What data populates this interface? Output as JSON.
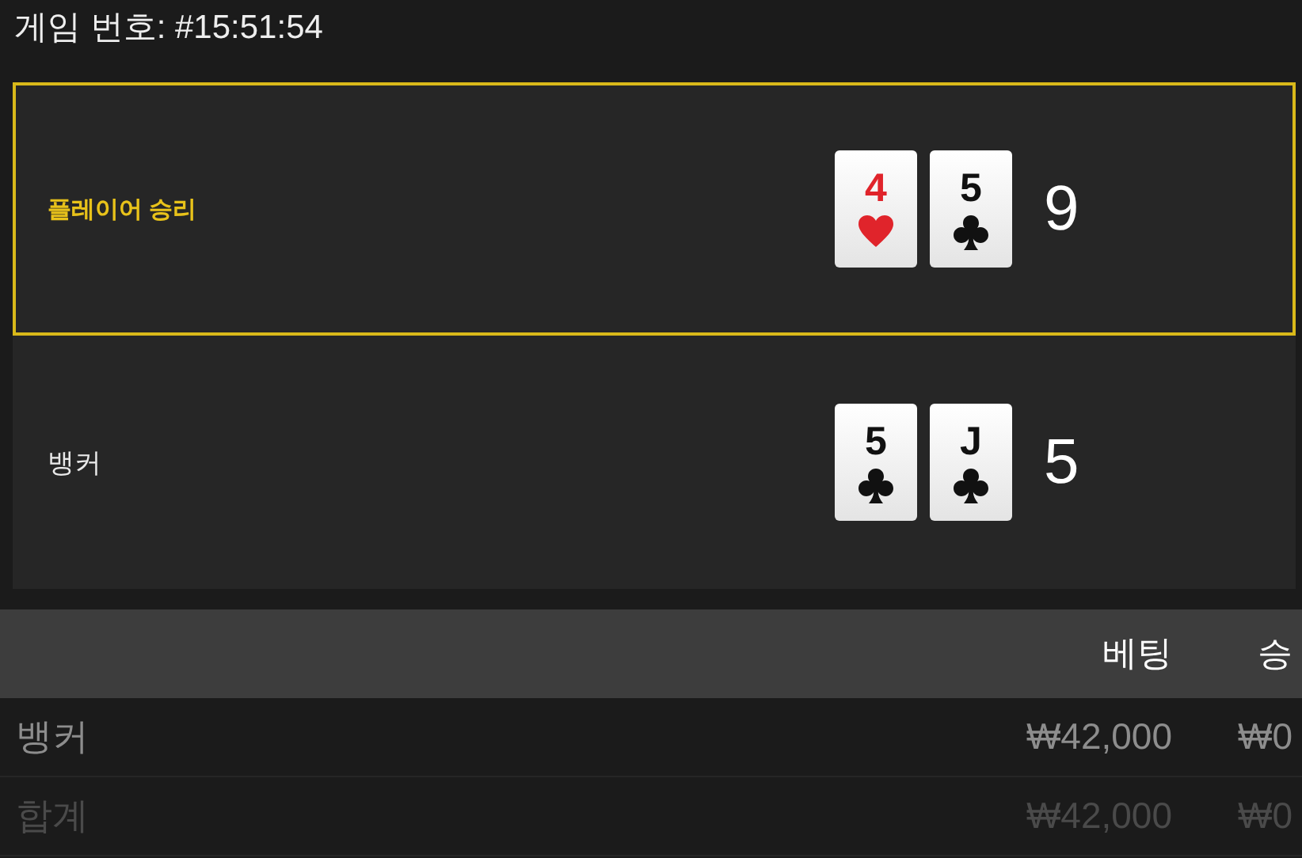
{
  "header": {
    "title": "게임 번호: #15:51:54"
  },
  "hands": [
    {
      "label": "플레이어 승리",
      "selected": true,
      "cards": [
        {
          "rank": "4",
          "kind": "heart"
        },
        {
          "rank": "5",
          "kind": "club"
        }
      ],
      "score": "9"
    },
    {
      "label": "뱅커",
      "selected": false,
      "cards": [
        {
          "rank": "5",
          "kind": "club"
        },
        {
          "rank": "J",
          "kind": "club"
        }
      ],
      "score": "5"
    }
  ],
  "table": {
    "columns": [
      "",
      "베팅",
      "승"
    ],
    "rows": [
      {
        "kind": "bet",
        "cells": [
          "뱅커",
          "₩42,000",
          "₩0"
        ]
      },
      {
        "kind": "total",
        "cells": [
          "합계",
          "₩42,000",
          "₩0"
        ]
      }
    ]
  }
}
